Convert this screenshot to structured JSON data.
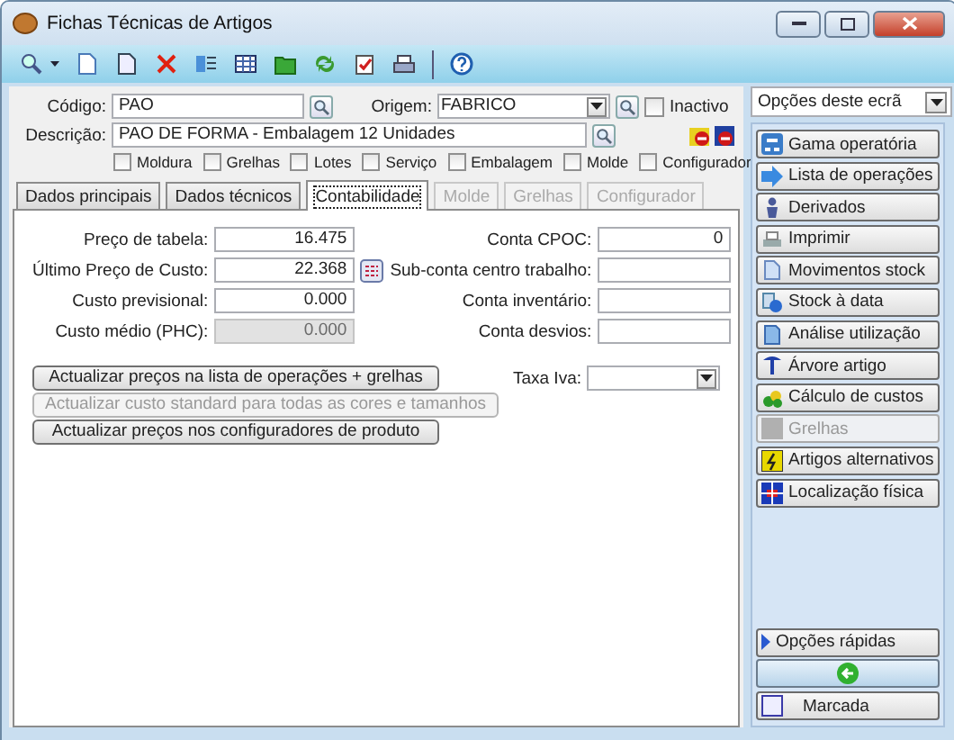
{
  "window": {
    "title": "Fichas Técnicas de Artigos"
  },
  "header": {
    "code": {
      "label": "Código:",
      "value": "PAO"
    },
    "origin": {
      "label": "Origem:",
      "value": "FABRICO"
    },
    "inactive": {
      "label": "Inactivo",
      "checked": false
    },
    "description": {
      "label": "Descrição:",
      "value": "PAO DE FORMA - Embalagem 12 Unidades"
    },
    "flags": [
      {
        "label": "Moldura",
        "checked": false
      },
      {
        "label": "Grelhas",
        "checked": false
      },
      {
        "label": "Lotes",
        "checked": false
      },
      {
        "label": "Serviço",
        "checked": false
      },
      {
        "label": "Embalagem",
        "checked": false
      },
      {
        "label": "Molde",
        "checked": false
      },
      {
        "label": "Configurador",
        "checked": false
      }
    ]
  },
  "tabs": [
    {
      "label": "Dados principais",
      "selected": false,
      "disabled": false
    },
    {
      "label": "Dados técnicos",
      "selected": false,
      "disabled": false
    },
    {
      "label": "Contabilidade",
      "selected": true,
      "disabled": false
    },
    {
      "label": "Molde",
      "selected": false,
      "disabled": true
    },
    {
      "label": "Grelhas",
      "selected": false,
      "disabled": true
    },
    {
      "label": "Configurador",
      "selected": false,
      "disabled": true
    }
  ],
  "accounting": {
    "cost_fields": [
      {
        "label": "Preço de tabela:",
        "value": "16.475",
        "disabled": false
      },
      {
        "label": "Último Preço de Custo:",
        "value": "22.368",
        "disabled": false
      },
      {
        "label": "Custo previsional:",
        "value": "0.000",
        "disabled": false
      },
      {
        "label": "Custo médio (PHC):",
        "value": "0.000",
        "disabled": true
      }
    ],
    "account_fields": [
      {
        "label": "Conta CPOC:",
        "value": "0"
      },
      {
        "label": "Sub-conta centro trabalho:"
      },
      {
        "label": "Conta inventário:"
      },
      {
        "label": "Conta desvios:"
      }
    ],
    "buttons": [
      {
        "label": "Actualizar preços na lista de operações + grelhas",
        "disabled": false
      },
      {
        "label": "Actualizar custo standard para todas as cores e tamanhos",
        "disabled": true
      },
      {
        "label": "Actualizar preços nos configuradores de produto",
        "disabled": false
      }
    ],
    "vat": {
      "label": "Taxa Iva:"
    }
  },
  "sidebar": {
    "options": {
      "value": "Opções deste ecrã"
    },
    "actions": [
      {
        "label": "Gama operatória",
        "disabled": false
      },
      {
        "label": "Lista de operações",
        "disabled": false
      },
      {
        "label": "Derivados",
        "disabled": false
      },
      {
        "label": "Imprimir",
        "disabled": false
      },
      {
        "label": "Movimentos stock",
        "disabled": false
      },
      {
        "label": "Stock à data",
        "disabled": false
      },
      {
        "label": "Análise utilização",
        "disabled": false
      },
      {
        "label": "Árvore artigo",
        "disabled": false
      },
      {
        "label": "Cálculo de custos",
        "disabled": false
      },
      {
        "label": "Grelhas",
        "disabled": true
      },
      {
        "label": "Artigos alternativos",
        "disabled": false
      },
      {
        "label": "Localização física",
        "disabled": false
      }
    ],
    "quick_options": {
      "label": "Opções rápidas"
    },
    "marked": {
      "label": "Marcada",
      "checked": false
    }
  }
}
